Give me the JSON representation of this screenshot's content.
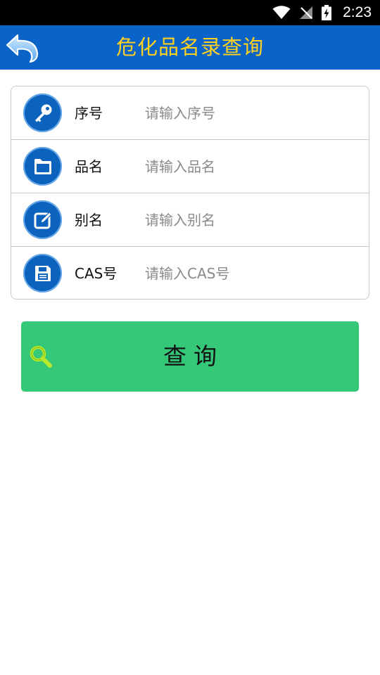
{
  "status_bar": {
    "time": "2:23",
    "icons": [
      "wifi-icon",
      "no-signal-icon",
      "battery-charging-icon"
    ]
  },
  "app_bar": {
    "title": "危化品名录查询",
    "back_icon": "back-arrow-icon",
    "background": "#0a63c8",
    "title_color": "#ffd21f"
  },
  "form": {
    "rows": [
      {
        "icon": "key-icon",
        "label": "序号",
        "placeholder": "请输入序号",
        "value": ""
      },
      {
        "icon": "folder-icon",
        "label": "品名",
        "placeholder": "请输入品名",
        "value": ""
      },
      {
        "icon": "edit-icon",
        "label": "别名",
        "placeholder": "请输入别名",
        "value": ""
      },
      {
        "icon": "save-icon",
        "label": "CAS号",
        "placeholder": "请输入CAS号",
        "value": ""
      }
    ]
  },
  "query_button": {
    "label": "查询",
    "icon": "search-icon",
    "color": "#35c879"
  }
}
